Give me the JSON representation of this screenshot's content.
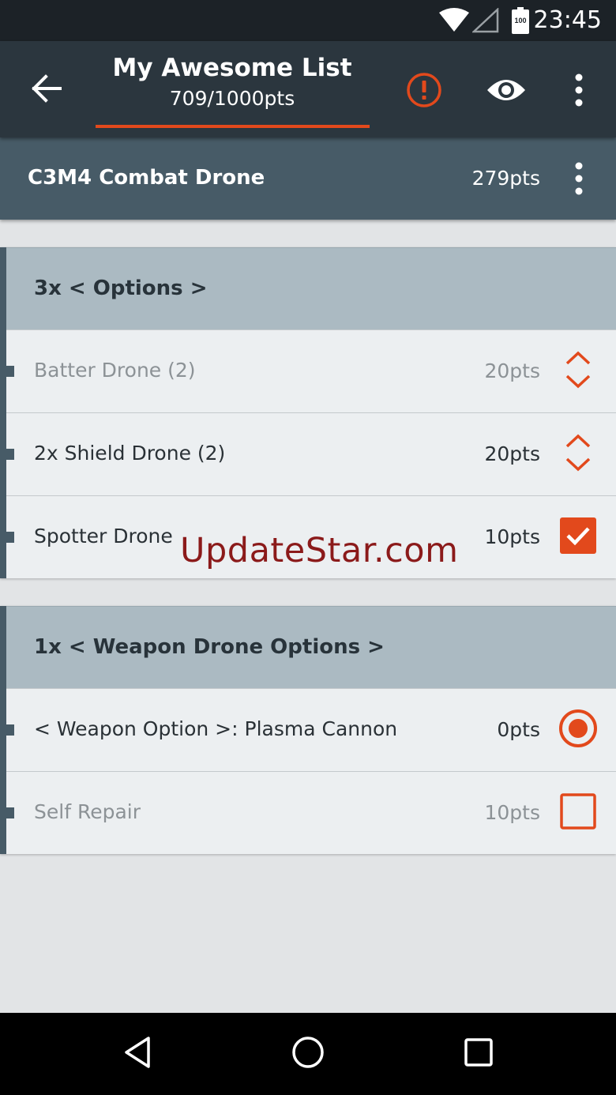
{
  "status_bar": {
    "time": "23:45",
    "battery_level": "100",
    "icons": [
      "wifi-icon",
      "signal-icon",
      "battery-icon"
    ]
  },
  "app_bar": {
    "title": "My Awesome List",
    "subtitle": "709/1000pts",
    "icons": [
      "arrow-back-icon",
      "warning-icon",
      "eye-icon",
      "more-vert-icon"
    ]
  },
  "unit": {
    "name": "C3M4 Combat Drone",
    "points": "279pts"
  },
  "groups": [
    {
      "title": "3x < Options >",
      "options": [
        {
          "label": "Batter Drone (2)",
          "points": "20pts",
          "control": "stepper",
          "enabled": false
        },
        {
          "label": "2x Shield Drone (2)",
          "points": "20pts",
          "control": "stepper",
          "enabled": true
        },
        {
          "label": "Spotter Drone",
          "points": "10pts",
          "control": "checkbox",
          "checked": true,
          "enabled": true
        }
      ]
    },
    {
      "title": "1x < Weapon Drone Options >",
      "options": [
        {
          "label": "< Weapon Option >: Plasma Cannon",
          "points": "0pts",
          "control": "radio",
          "selected": true,
          "enabled": true
        },
        {
          "label": "Self Repair",
          "points": "10pts",
          "control": "checkbox",
          "checked": false,
          "enabled": false
        }
      ]
    }
  ],
  "watermark": "UpdateStar.com",
  "nav_bar": {
    "icons": [
      "back-triangle-icon",
      "home-circle-icon",
      "recents-square-icon"
    ]
  },
  "colors": {
    "accent": "#e2491c",
    "app_bar": "#2b363e",
    "unit_header": "#475b67",
    "group_header": "#abbac2",
    "row_background": "#eceff1",
    "page_background": "#e2e4e6"
  }
}
